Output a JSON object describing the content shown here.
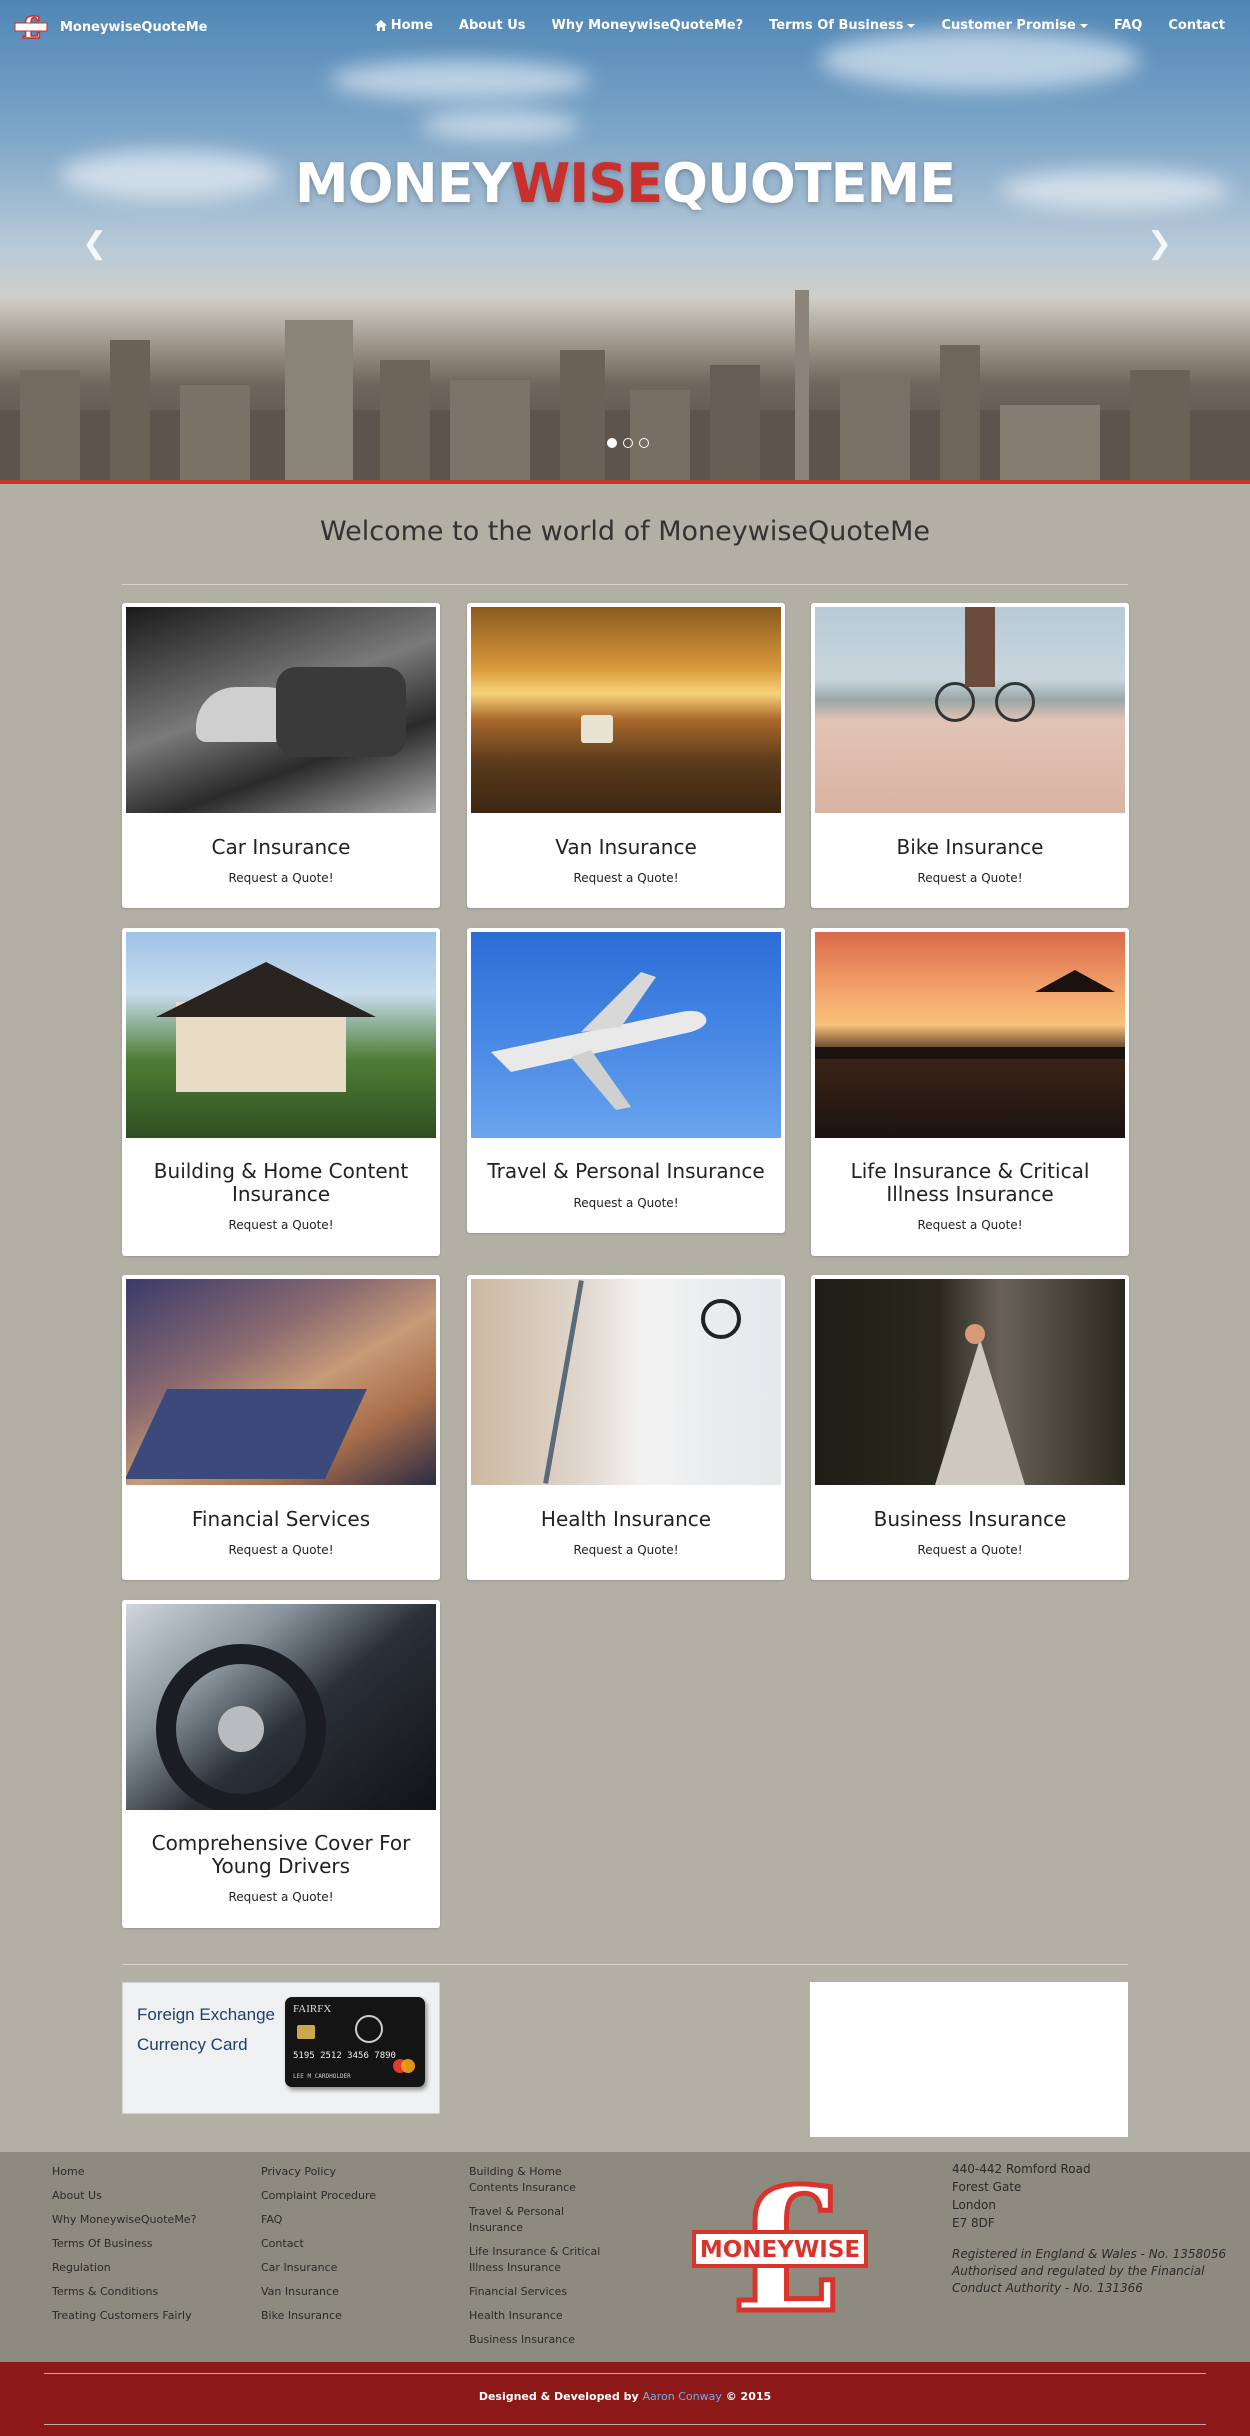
{
  "nav": {
    "brand": "MoneywiseQuoteMe",
    "items": [
      {
        "label": "Home",
        "icon": "home-icon"
      },
      {
        "label": "About Us"
      },
      {
        "label": "Why MoneywiseQuoteMe?"
      },
      {
        "label": "Terms Of Business",
        "dropdown": true
      },
      {
        "label": "Customer Promise",
        "dropdown": true
      },
      {
        "label": "FAQ"
      },
      {
        "label": "Contact"
      }
    ]
  },
  "hero": {
    "title_part1": "MONEY",
    "title_part2": "WISE",
    "title_part3": "QUOTEME",
    "active_slide": 1,
    "slide_count": 3
  },
  "welcome": "Welcome to the world of MoneywiseQuoteMe",
  "cards": [
    {
      "title": "Car Insurance",
      "cta": "Request a Quote!"
    },
    {
      "title": "Van Insurance",
      "cta": "Request a Quote!"
    },
    {
      "title": "Bike Insurance",
      "cta": "Request a Quote!"
    },
    {
      "title": "Building & Home Content Insurance",
      "cta": "Request a Quote!"
    },
    {
      "title": "Travel & Personal Insurance",
      "cta": "Request a Quote!"
    },
    {
      "title": "Life Insurance & Critical Illness Insurance",
      "cta": "Request a Quote!"
    },
    {
      "title": "Financial Services",
      "cta": "Request a Quote!"
    },
    {
      "title": "Health Insurance",
      "cta": "Request a Quote!"
    },
    {
      "title": "Business Insurance",
      "cta": "Request a Quote!"
    },
    {
      "title": "Comprehensive Cover For Young Drivers",
      "cta": "Request a Quote!"
    }
  ],
  "ad": {
    "line1": "Foreign Exchange",
    "line2": "Currency Card",
    "card_brand": "FAIRFX",
    "card_number": "5195 2512 3456 7890",
    "card_holder": "LEE M CARDHOLDER"
  },
  "footer": {
    "col1": [
      "Home",
      "About Us",
      "Why MoneywiseQuoteMe?",
      "Terms Of Business",
      "Regulation",
      "Terms & Conditions",
      "Treating Customers Fairly"
    ],
    "col2": [
      "Privacy Policy",
      "Complaint Procedure",
      "FAQ",
      "Contact",
      "Car Insurance",
      "Van Insurance",
      "Bike Insurance"
    ],
    "col3": [
      "Building & Home Contents Insurance",
      "Travel & Personal Insurance",
      "Life Insurance & Critical Illness Insurance",
      "Financial Services",
      "Health Insurance",
      "Business Insurance"
    ],
    "logo_text": "MONEYWISE",
    "address": [
      "440-442 Romford Road",
      "Forest Gate",
      "London",
      "E7 8DF"
    ],
    "legal": [
      "Registered in England & Wales - No. 1358056",
      "Authorised and regulated by the Financial",
      "Conduct Authority - No. 131366"
    ]
  },
  "credits": {
    "prefix": "Designed & Developed by",
    "author": "Aaron Conway",
    "suffix": "© 2015"
  },
  "colors": {
    "accent_red": "#c9302c",
    "footer_bar": "#8c1918",
    "page_bg": "#b2afa5"
  }
}
